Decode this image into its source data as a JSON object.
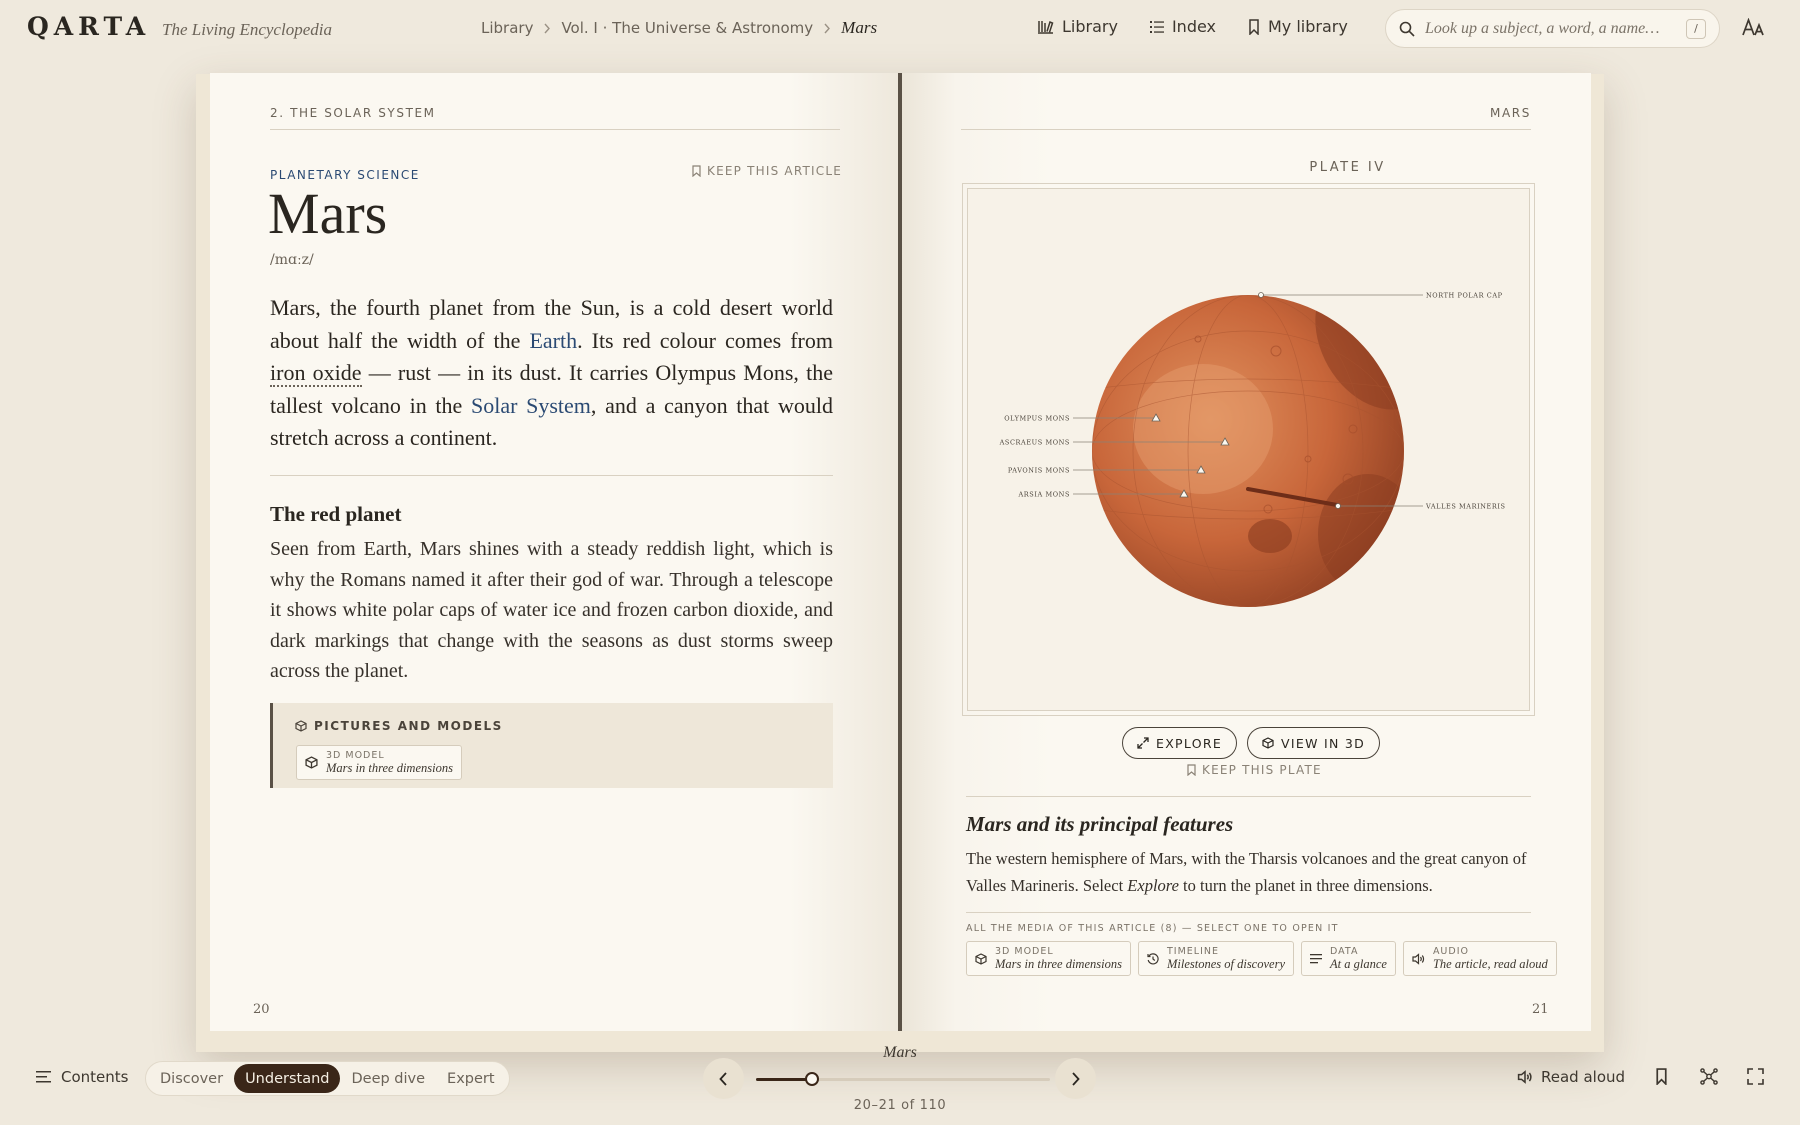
{
  "header": {
    "logo": "QARTA",
    "tagline": "The Living Encyclopedia",
    "breadcrumb": [
      "Library",
      "Vol. I · The Universe & Astronomy",
      "Mars"
    ],
    "nav": [
      {
        "label": "Library",
        "icon": "library-icon"
      },
      {
        "label": "Index",
        "icon": "index-icon"
      },
      {
        "label": "My library",
        "icon": "bookmark-icon"
      }
    ],
    "search_placeholder": "Look up a subject, a word, a name…",
    "search_shortcut": "/"
  },
  "left_page": {
    "running_head": "2. THE SOLAR SYSTEM",
    "kicker": "PLANETARY SCIENCE",
    "keep_label": "KEEP THIS ARTICLE",
    "title": "Mars",
    "pronunciation": "/mɑːz/",
    "lead": {
      "t1": "Mars, the fourth planet from the Sun, is a cold desert world about half the width of the ",
      "link1": "Earth",
      "t2": ". Its red colour comes from ",
      "term": "iron oxide",
      "t3": " — rust — in its dust. It carries Olympus Mons, the tallest volcano in the ",
      "link2": "Solar System",
      "t4": ", and a canyon that would stretch across a continent."
    },
    "section_title": "The red planet",
    "section_body": "Seen from Earth, Mars shines with a steady reddish light, which is why the Romans named it after their god of war. Through a telescope it shows white polar caps of water ice and frozen carbon dioxide, and dark markings that change with the seasons as dust storms sweep across the planet.",
    "media_box": {
      "heading": "PICTURES AND MODELS",
      "item_type": "3D MODEL",
      "item_desc": "Mars in three dimensions"
    },
    "folio": "20"
  },
  "right_page": {
    "running_head": "MARS",
    "plate_label": "PLATE IV",
    "plate_labels": {
      "north": "NORTH POLAR CAP",
      "olympus": "OLYMPUS MONS",
      "ascraeus": "ASCRAEUS MONS",
      "pavonis": "PAVONIS MONS",
      "arsia": "ARSIA MONS",
      "valles": "VALLES MARINERIS"
    },
    "explore_label": "EXPLORE",
    "view3d_label": "VIEW IN 3D",
    "keep_plate_label": "KEEP THIS PLATE",
    "caption_title": "Mars and its principal features",
    "caption_t1": "The western hemisphere of Mars, with the Tharsis volcanoes and the great canyon of Valles Marineris. Select ",
    "caption_em": "Explore",
    "caption_t2": " to turn the planet in three dimensions.",
    "media_all": "ALL THE MEDIA OF THIS ARTICLE (8) — SELECT ONE TO OPEN IT",
    "media": [
      {
        "type": "3D MODEL",
        "desc": "Mars in three dimensions",
        "icon": "cube-icon"
      },
      {
        "type": "TIMELINE",
        "desc": "Milestones of discovery",
        "icon": "history-icon"
      },
      {
        "type": "DATA",
        "desc": "At a glance",
        "icon": "list-icon"
      },
      {
        "type": "AUDIO",
        "desc": "The article, read aloud",
        "icon": "speaker-icon"
      }
    ],
    "folio": "21"
  },
  "footer": {
    "contents_label": "Contents",
    "levels": [
      "Discover",
      "Understand",
      "Deep dive",
      "Expert"
    ],
    "active_level": "Understand",
    "nav_title": "Mars",
    "page_count": "20–21 of 110",
    "progress": 0.19,
    "read_aloud": "Read aloud"
  },
  "colors": {
    "background": "#efe9dd",
    "page": "#fbf8f1",
    "accent_link": "#2b4a73",
    "active_level": "#3a2618",
    "mars": "#c8663a"
  }
}
